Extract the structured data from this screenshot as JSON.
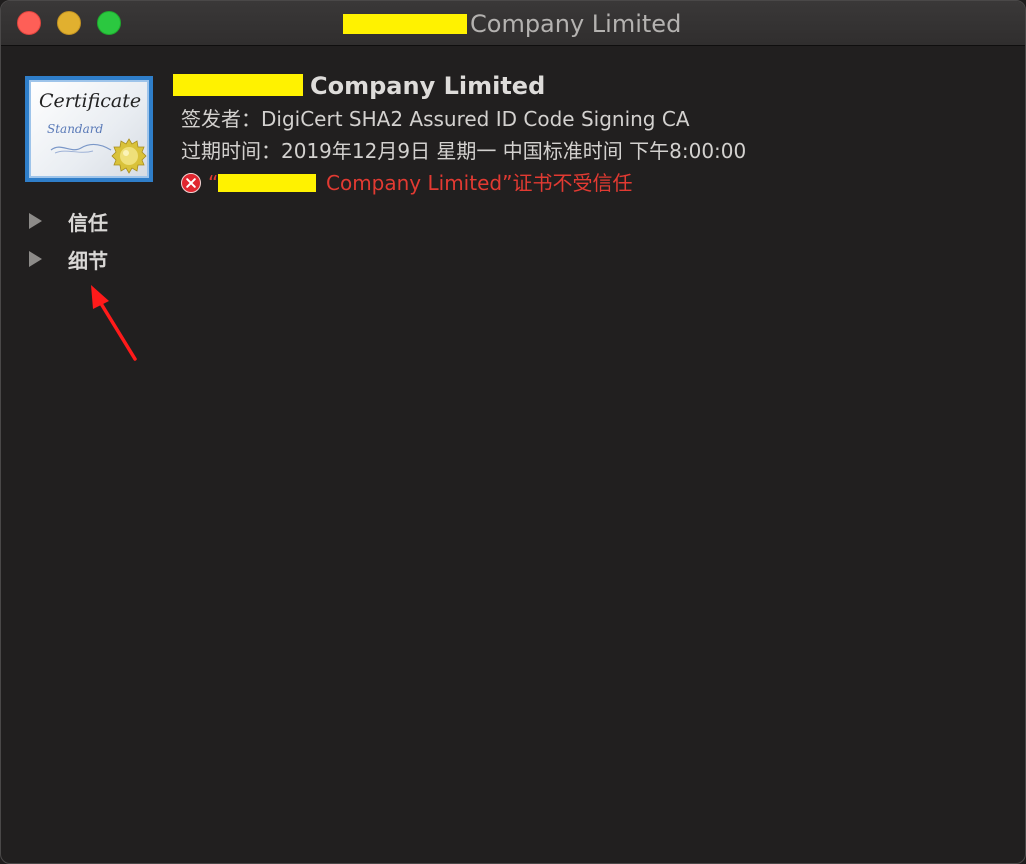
{
  "window": {
    "title": "Company Limited"
  },
  "certificate": {
    "icon_script": "Certificate",
    "icon_subtitle": "Standard",
    "name": "Company Limited",
    "issuer_line": "签发者：DigiCert SHA2 Assured ID Code Signing CA",
    "expiry_line": "过期时间：2019年12月9日 星期一 中国标准时间 下午8:00:00",
    "warning_quote_open": "“",
    "warning_text": "Company Limited”证书不受信任",
    "warning_color": "#e23a32"
  },
  "sections": {
    "trust_label": "信任",
    "details_label": "细节"
  },
  "annotations": {
    "arrow_color": "#ff1a1a"
  },
  "redaction_color": "#fff200"
}
